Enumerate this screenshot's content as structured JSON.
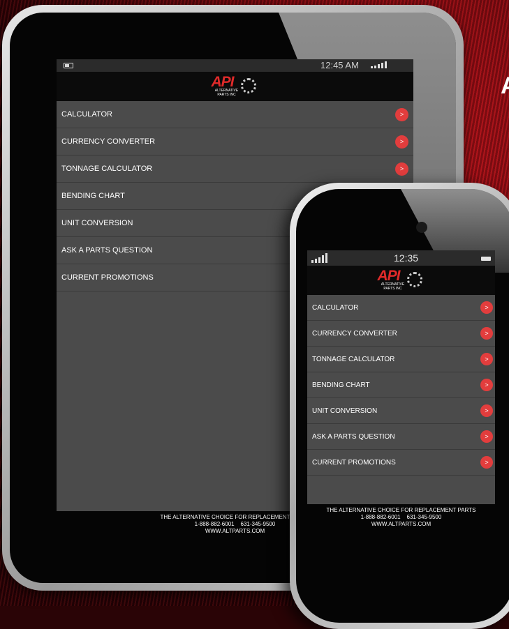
{
  "background": {
    "partial_heading": "A"
  },
  "tablet": {
    "status": {
      "time": "12:45 AM"
    },
    "logo": {
      "mark": "API",
      "subtitle_line1": "ALTERNATIVE",
      "subtitle_line2": "PARTS INC"
    },
    "menu": [
      {
        "label": "CALCULATOR",
        "has_arrow": true
      },
      {
        "label": "CURRENCY CONVERTER",
        "has_arrow": true
      },
      {
        "label": "TONNAGE CALCULATOR",
        "has_arrow": true
      },
      {
        "label": "BENDING CHART",
        "has_arrow": false
      },
      {
        "label": "UNIT CONVERSION",
        "has_arrow": false
      },
      {
        "label": "ASK A PARTS QUESTION",
        "has_arrow": false
      },
      {
        "label": "CURRENT PROMOTIONS",
        "has_arrow": false
      }
    ],
    "arrow_glyph": ">",
    "footer": {
      "line1": "THE ALTERNATIVE CHOICE FOR REPLACEMENT PARTS",
      "line2": "1-888-882-6001    631-345-9500",
      "line3": "WWW.ALTPARTS.COM"
    }
  },
  "phone": {
    "status": {
      "time": "12:35"
    },
    "logo": {
      "mark": "API",
      "subtitle_line1": "ALTERNATIVE",
      "subtitle_line2": "PARTS INC"
    },
    "menu": [
      {
        "label": "CALCULATOR"
      },
      {
        "label": "CURRENCY CONVERTER"
      },
      {
        "label": "TONNAGE CALCULATOR"
      },
      {
        "label": "BENDING CHART"
      },
      {
        "label": "UNIT CONVERSION"
      },
      {
        "label": "ASK A PARTS QUESTION"
      },
      {
        "label": "CURRENT PROMOTIONS"
      }
    ],
    "arrow_glyph": ">",
    "footer": {
      "line1": "THE ALTERNATIVE CHOICE FOR REPLACEMENT PARTS",
      "line2": "1-888-882-6001    631-345-9500",
      "line3": "WWW.ALTPARTS.COM"
    }
  },
  "colors": {
    "accent": "#e23d3d",
    "menu_bg": "#4b4b4b",
    "header_bg": "#0b0b0b"
  }
}
